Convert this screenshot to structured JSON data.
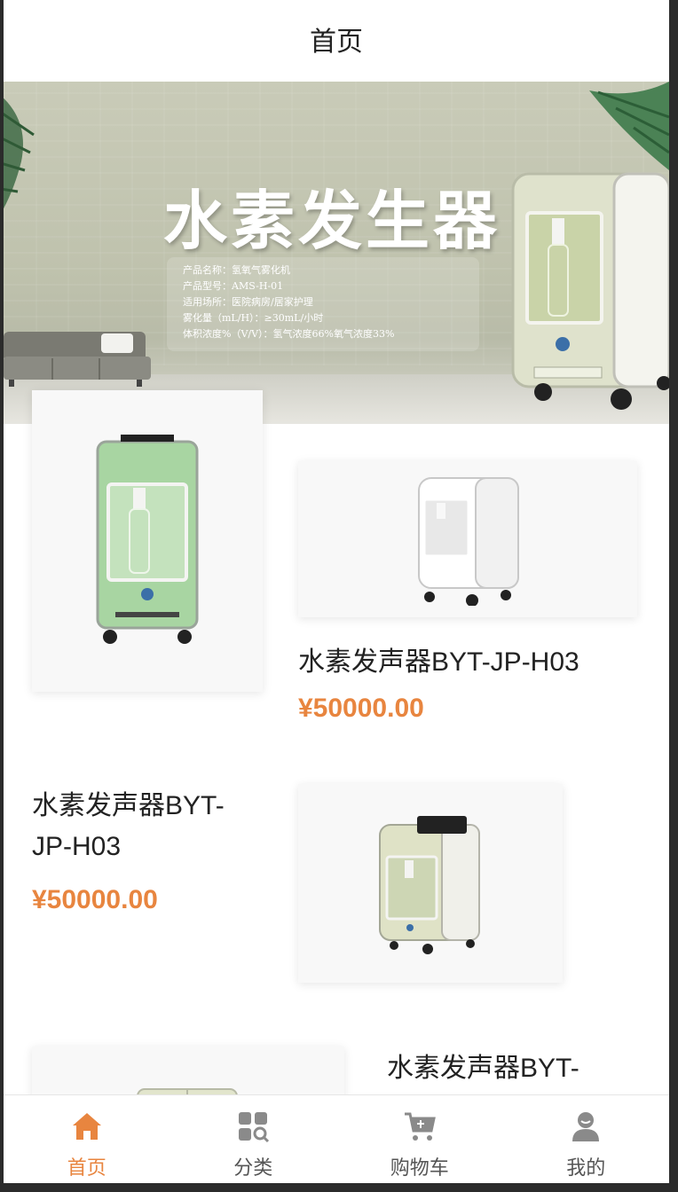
{
  "header": {
    "title": "首页"
  },
  "banner": {
    "title": "水素发生器",
    "specs": [
      "产品名称：氢氧气雾化机",
      "产品型号：AMS-H-01",
      "适用场所：医院病房/居家护理",
      "雾化量（mL/H）：≥30mL/小时",
      "体积浓度%（V/V）：氢气浓度66%氧气浓度33%"
    ]
  },
  "products": [
    {
      "name": "水素发声器BYT-JP-H03",
      "price": "¥50000.00",
      "device_color": "green"
    },
    {
      "name_line1": "水素发声器BYT-",
      "name_line2": "JP-H03",
      "price": "¥50000.00",
      "device_color": "white"
    },
    {
      "name_line1": "水素发声器BYT-",
      "device_color": "beige"
    }
  ],
  "tabbar": {
    "items": [
      {
        "label": "首页",
        "icon": "home-icon",
        "active": true
      },
      {
        "label": "分类",
        "icon": "category-icon",
        "active": false
      },
      {
        "label": "购物车",
        "icon": "cart-icon",
        "active": false
      },
      {
        "label": "我的",
        "icon": "user-icon",
        "active": false
      }
    ]
  },
  "colors": {
    "accent": "#e8853f",
    "tab_inactive": "#555555",
    "icon_inactive": "#8a8a8a"
  }
}
